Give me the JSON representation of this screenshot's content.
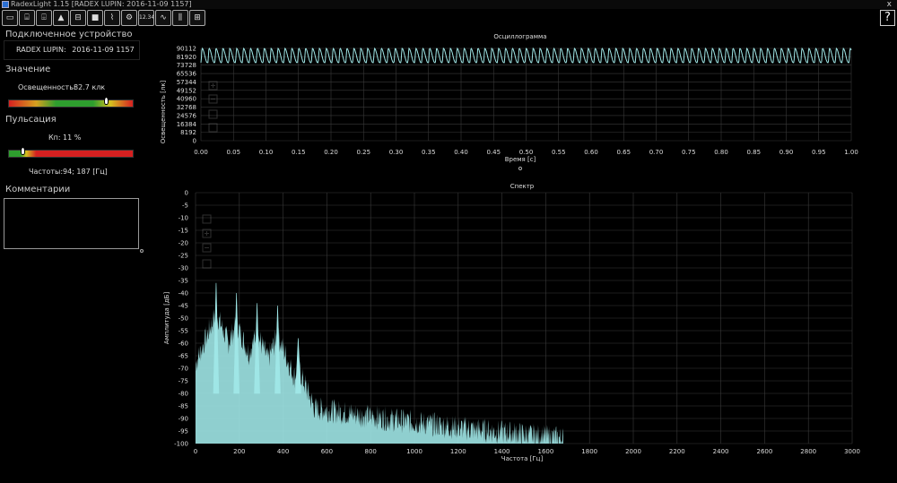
{
  "window": {
    "title": "RadexLight 1.15 [RADEX LUPIN: 2016-11-09 1157]",
    "close_label": "x"
  },
  "toolbar": {
    "buttons": [
      {
        "name": "new-window-icon",
        "glyph": "▭"
      },
      {
        "name": "open-folder-icon",
        "glyph": "⌸"
      },
      {
        "name": "open-file-icon",
        "glyph": "⌹"
      },
      {
        "name": "eject-icon",
        "glyph": "▲"
      },
      {
        "name": "save-icon",
        "glyph": "⊟"
      },
      {
        "name": "stop-icon",
        "glyph": "■"
      },
      {
        "name": "signal-icon",
        "glyph": "⌇"
      },
      {
        "name": "device-icon",
        "glyph": "⚙"
      },
      {
        "name": "clock-icon",
        "glyph": "12.34"
      },
      {
        "name": "waveform-icon",
        "glyph": "∿"
      },
      {
        "name": "spectrum-icon",
        "glyph": "⫼"
      },
      {
        "name": "layout-icon",
        "glyph": "⊞"
      }
    ],
    "help_label": "?"
  },
  "left": {
    "device_header": "Подключенное устройство",
    "device_name": "RADEX LUPIN:",
    "device_date": "2016-11-09 1157",
    "value_header": "Значение",
    "illuminance_label": "Освещенность:",
    "illuminance_value": "82.7 клк",
    "illuminance_level": 0.78,
    "pulsation_header": "Пульсация",
    "kp_label": "Кп:",
    "kp_value": "11 %",
    "kp_level": 0.11,
    "freq_label": "Частоты:",
    "freq_value": "94; 187 [Гц]",
    "comments_header": "Комментарии"
  },
  "osc": {
    "title": "Осциллограмма",
    "xlabel": "Время [с]",
    "ylabel": "Освещенность [лк]",
    "plot_color": "#9fe6e6"
  },
  "spec": {
    "title": "Спектр",
    "xlabel": "Частота [Гц]",
    "ylabel": "Амплитуда [дБ]",
    "plot_color": "#9fe6e6"
  },
  "chart_data": [
    {
      "type": "line",
      "title": "Осциллограмма",
      "xlabel": "Время [с]",
      "ylabel": "Освещенность [лк]",
      "xlim": [
        0,
        1.0
      ],
      "ylim": [
        0,
        90112
      ],
      "x_ticks": [
        "0.00",
        "0.05",
        "0.10",
        "0.15",
        "0.20",
        "0.25",
        "0.30",
        "0.35",
        "0.40",
        "0.45",
        "0.50",
        "0.55",
        "0.60",
        "0.65",
        "0.70",
        "0.75",
        "0.80",
        "0.85",
        "0.90",
        "0.95",
        "1.00"
      ],
      "y_ticks": [
        "90112",
        "81920",
        "73728",
        "65536",
        "57344",
        "49152",
        "40960",
        "32768",
        "24576",
        "16384",
        "8192",
        "0"
      ],
      "series": [
        {
          "period_s": 0.0106,
          "min": 73728,
          "max": 90112
        }
      ],
      "grid": true
    },
    {
      "type": "line",
      "title": "Спектр",
      "xlabel": "Частота [Гц]",
      "ylabel": "Амплитуда [дБ]",
      "xlim": [
        0,
        3000
      ],
      "ylim": [
        -100,
        0
      ],
      "x_ticks": [
        "0",
        "200",
        "400",
        "600",
        "800",
        "1000",
        "1200",
        "1400",
        "1600",
        "1800",
        "2000",
        "2200",
        "2400",
        "2600",
        "2800",
        "3000"
      ],
      "y_ticks": [
        "0",
        "-5",
        "-10",
        "-15",
        "-20",
        "-25",
        "-30",
        "-35",
        "-40",
        "-45",
        "-50",
        "-55",
        "-60",
        "-65",
        "-70",
        "-75",
        "-80",
        "-85",
        "-90",
        "-95",
        "-100"
      ],
      "peaks": [
        {
          "x": 94,
          "y": -36
        },
        {
          "x": 187,
          "y": -40
        },
        {
          "x": 281,
          "y": -44
        },
        {
          "x": 375,
          "y": -45
        },
        {
          "x": 469,
          "y": -58
        }
      ],
      "noise_floor_end_hz": 1680,
      "grid": true
    }
  ]
}
